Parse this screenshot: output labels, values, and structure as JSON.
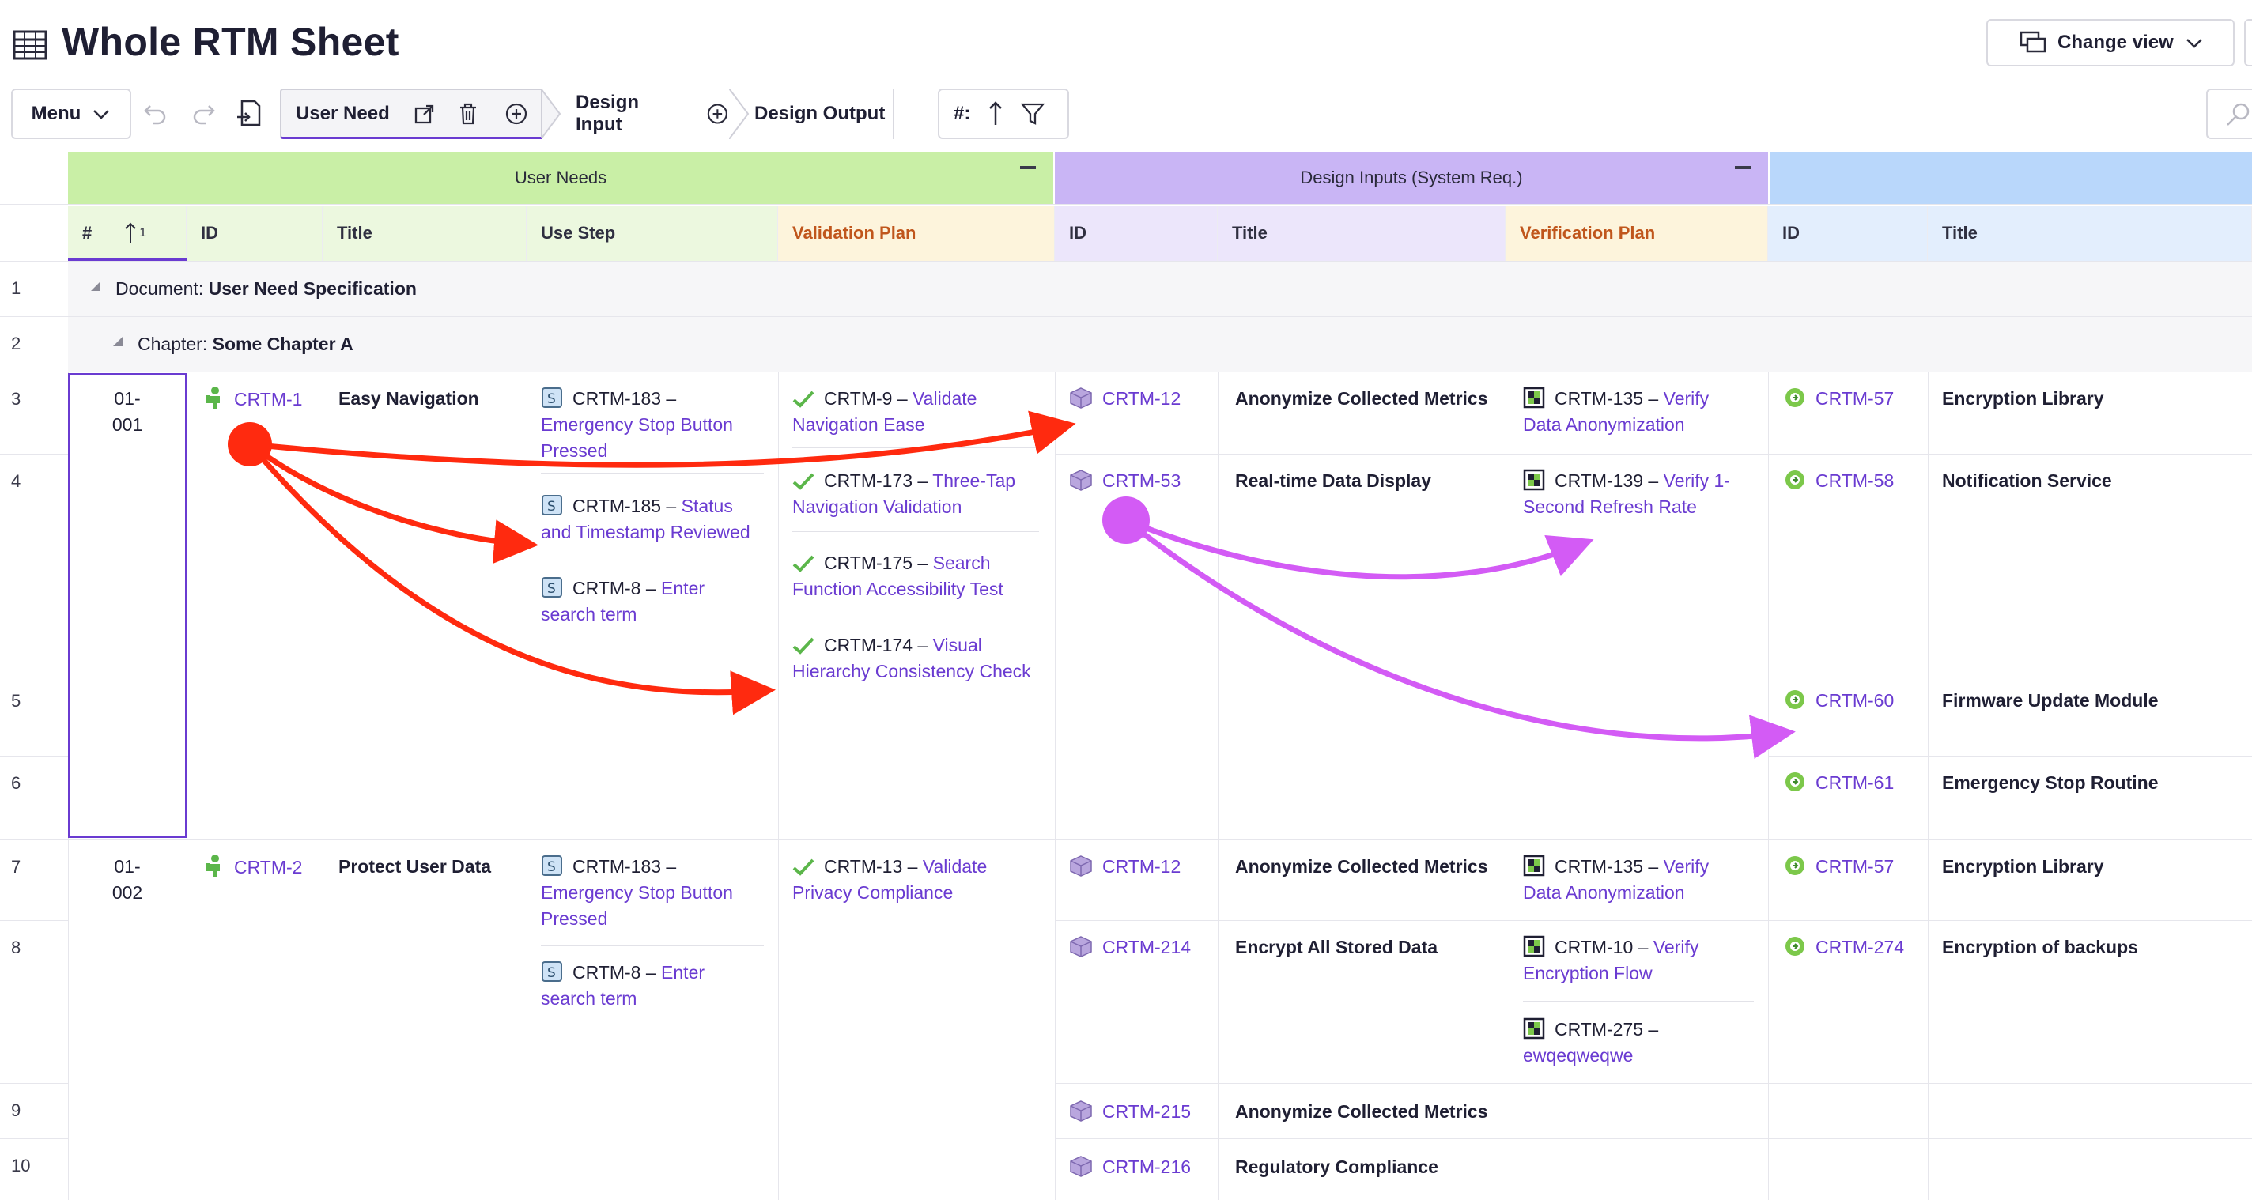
{
  "header": {
    "title": "Whole RTM Sheet",
    "change_view_label": "Change view"
  },
  "toolbar": {
    "menu_label": "Menu",
    "tabs": [
      {
        "label": "User Need"
      },
      {
        "label": "Design Input"
      },
      {
        "label": "Design Output"
      }
    ],
    "sort_label": "#:"
  },
  "bands": [
    {
      "label": "User Needs",
      "color": "#c9efa6"
    },
    {
      "label": "Design Inputs (System Req.)",
      "color": "#c9b5f5"
    },
    {
      "label": "",
      "color": "#b9d7fb"
    }
  ],
  "columns": {
    "num": "#",
    "sort_indicator": "1",
    "un_id": "ID",
    "un_title": "Title",
    "use_step": "Use Step",
    "validation_plan": "Validation Plan",
    "di_id": "ID",
    "di_title": "Title",
    "verification_plan": "Verification Plan",
    "do_id": "ID",
    "do_title": "Title"
  },
  "row_numbers": [
    "1",
    "2",
    "3",
    "4",
    "5",
    "6",
    "7",
    "8",
    "9",
    "10"
  ],
  "groups": {
    "document_prefix": "Document:",
    "document_name": "User Need Specification",
    "chapter_prefix": "Chapter:",
    "chapter_name": "Some Chapter A"
  },
  "user_needs": [
    {
      "num_line1": "01-",
      "num_line2": "001",
      "id": "CRTM-1",
      "title": "Easy Navigation",
      "use_steps": [
        {
          "id": "CRTM-183 –",
          "l1": "Emergency Stop Button",
          "l2": "Pressed"
        },
        {
          "id": "CRTM-185 –",
          "l0": "Status",
          "l1": "and Timestamp Reviewed"
        },
        {
          "id": "CRTM-8 –",
          "l0": "Enter",
          "l1": "search term"
        }
      ],
      "validation": [
        {
          "id": "CRTM-9 –",
          "l0": "Validate",
          "l1": "Navigation Ease"
        },
        {
          "id": "CRTM-173 –",
          "l0": "Three-Tap",
          "l1": "Navigation Validation"
        },
        {
          "id": "CRTM-175 –",
          "l0": "Search",
          "l1": "Function Accessibility Test"
        },
        {
          "id": "CRTM-174 –",
          "l0": "Visual",
          "l1": "Hierarchy Consistency Check"
        }
      ]
    },
    {
      "num_line1": "01-",
      "num_line2": "002",
      "id": "CRTM-2",
      "title": "Protect User Data",
      "use_steps": [
        {
          "id": "CRTM-183 –",
          "l1": "Emergency Stop Button",
          "l2": "Pressed"
        },
        {
          "id": "CRTM-8 –",
          "l0": "Enter",
          "l1": "search term"
        }
      ],
      "validation": [
        {
          "id": "CRTM-13 –",
          "l0": "Validate",
          "l1": "Privacy Compliance"
        }
      ]
    }
  ],
  "design_inputs": [
    {
      "id": "CRTM-12",
      "title": "Anonymize Collected Metrics",
      "ver_id": "CRTM-135 –",
      "ver_l0": "Verify",
      "ver_l1": "Data Anonymization"
    },
    {
      "id": "CRTM-53",
      "title": "Real-time Data Display",
      "ver_id": "CRTM-139 –",
      "ver_l0": "Verify 1-",
      "ver_l1": "Second Refresh Rate"
    },
    {
      "id": "CRTM-12",
      "title": "Anonymize Collected Metrics",
      "ver_id": "CRTM-135 –",
      "ver_l0": "Verify",
      "ver_l1": "Data Anonymization"
    },
    {
      "id": "CRTM-214",
      "title": "Encrypt All Stored Data",
      "ver_id": "CRTM-10 –",
      "ver_l0": "Verify",
      "ver_l1": "Encryption Flow",
      "ver2_id": "CRTM-275 –",
      "ver2_l1": "ewqeqweqwe"
    },
    {
      "id": "CRTM-215",
      "title": "Anonymize Collected Metrics"
    },
    {
      "id": "CRTM-216",
      "title": "Regulatory Compliance"
    }
  ],
  "design_outputs": [
    {
      "id": "CRTM-57",
      "title": "Encryption Library"
    },
    {
      "id": "CRTM-58",
      "title": "Notification Service"
    },
    {
      "id": "CRTM-60",
      "title": "Firmware Update Module"
    },
    {
      "id": "CRTM-61",
      "title": "Emergency Stop Routine"
    },
    {
      "id": "CRTM-57",
      "title": "Encryption Library"
    },
    {
      "id": "CRTM-274",
      "title": "Encryption of backups"
    }
  ],
  "colors": {
    "accent": "#6a3bd1",
    "arrow_red": "#ff2a0f",
    "arrow_magenta": "#d35bf5",
    "un_header_bg": "#ecf8df",
    "di_header_bg": "#ece6fb",
    "do_header_bg": "#e3eefd",
    "plan_header_bg": "#fdf4dc",
    "plan_header_text": "#c0561c"
  }
}
